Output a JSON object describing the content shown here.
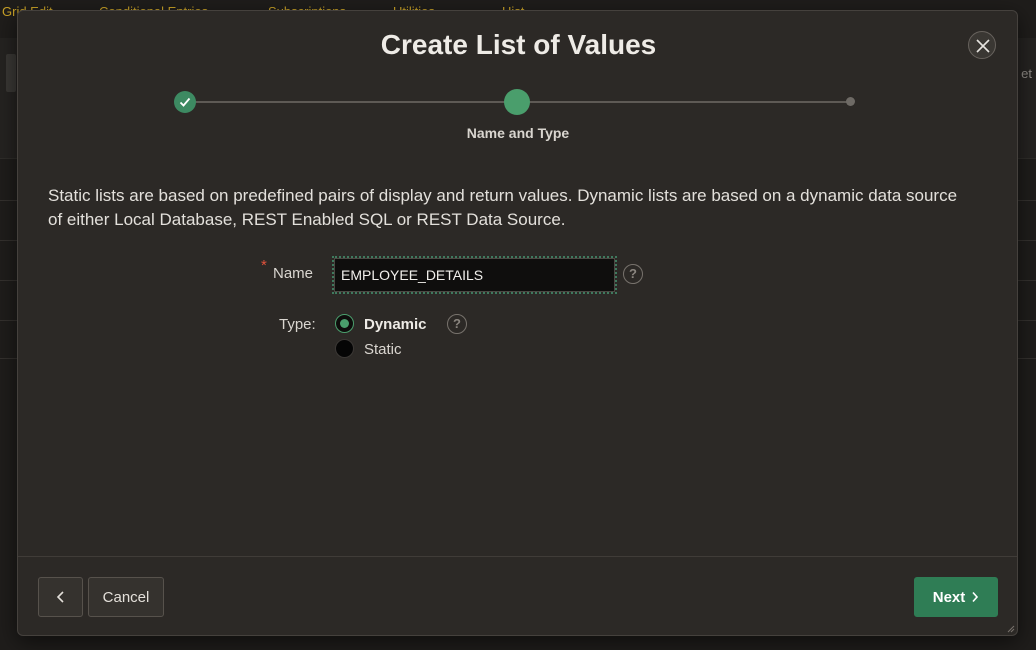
{
  "background": {
    "tabs": [
      "Grid Edit",
      "Conditional Entries",
      "Subscriptions",
      "Utilities",
      "Hist"
    ],
    "right_fragment": "et"
  },
  "dialog": {
    "title": "Create List of Values",
    "close_icon": "close-icon",
    "wizard": {
      "steps": [
        {
          "state": "complete"
        },
        {
          "state": "current",
          "label": "Name and Type"
        },
        {
          "state": "upcoming"
        }
      ],
      "current_label": "Name and Type"
    },
    "description": "Static lists are based on predefined pairs of display and return values. Dynamic lists are based on a dynamic data source of either Local Database, REST Enabled SQL or REST Data Source.",
    "name_field": {
      "required_marker": "*",
      "label": "Name",
      "value": "EMPLOYEE_DETAILS",
      "help_icon": "help-icon"
    },
    "type_field": {
      "label": "Type:",
      "options": [
        {
          "label": "Dynamic",
          "selected": true
        },
        {
          "label": "Static",
          "selected": false
        }
      ],
      "help_icon": "help-icon"
    },
    "footer": {
      "back_icon": "chevron-left-icon",
      "cancel_label": "Cancel",
      "next_label": "Next",
      "next_icon": "chevron-right-icon"
    }
  },
  "colors": {
    "accent_green": "#4a9e6c",
    "button_green": "#2f7d55",
    "background_tab_text": "#c9a227",
    "required_red": "#e2523c"
  }
}
